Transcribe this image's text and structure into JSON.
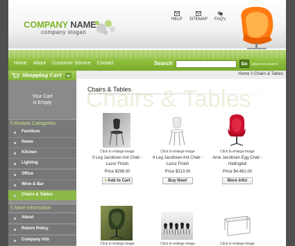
{
  "brand": {
    "name_part1": "COMPANY",
    "name_part2": " NAME",
    "slogan": "company slogan"
  },
  "top_links": [
    {
      "label": "HELP",
      "icon": "mail-icon"
    },
    {
      "label": "SITEMAP",
      "icon": "mail-icon"
    },
    {
      "label": "FAQ's",
      "icon": "help-icon"
    }
  ],
  "nav": {
    "links": [
      "Home",
      "About",
      "Customer Service",
      "Contact"
    ],
    "search_label": "Search",
    "search_value": "",
    "go_label": "Go",
    "advanced_label": "advanced search"
  },
  "cart": {
    "header": "Shopping Cart",
    "line1": "Your Cart",
    "line2": "is Empty"
  },
  "categories": {
    "header": "\\\\ Browse Categories",
    "items": [
      "Furniture",
      "Home",
      "Kitchen",
      "Lighting",
      "Office",
      "Wine & Bar",
      "Chairs & Tables"
    ],
    "active": "Chairs & Tables"
  },
  "more_info": {
    "header": "\\\\ More Information",
    "items": [
      "About",
      "Return Policy",
      "Company Info"
    ]
  },
  "breadcrumb": "Home \\\\ Chairs & Tables",
  "page_title": "Chairs & Tables",
  "page_title_watermark": "Chairs & Tables",
  "products": [
    {
      "enlarge": "Click to enlarge image",
      "name": "3 Leg Jacobsen Ant Chair - Lazur Finish",
      "price": "Price $298.00",
      "button": "Add to Cart",
      "button_plus": "+"
    },
    {
      "enlarge": "Click to enlarge image",
      "name": "4 Leg Jacobsen Ant Chair - Lazur Finish",
      "price": "Price $313.00",
      "button": "Buy Now!"
    },
    {
      "enlarge": "Click to enlarge image",
      "name": "Arne Jacobsen Egg Chair - Hallingdal",
      "price": "Price $4,481.00",
      "button": "More Info!"
    },
    {
      "enlarge": "Click to enlarge image"
    },
    {
      "enlarge": "Click to enlarge image"
    },
    {
      "enlarge": "Click to enlarge image"
    }
  ],
  "colors": {
    "accent_green": "#8dbf3c",
    "sidebar_gray": "#777777",
    "background": "#4f4f4f"
  }
}
